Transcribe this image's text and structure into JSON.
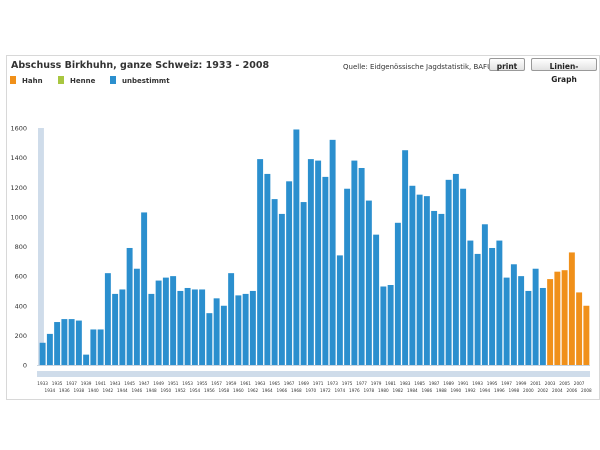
{
  "header": {
    "title": "Abschuss Birkhuhn, ganze Schweiz: 1933 - 2008",
    "source": "Quelle: Eidgenössische Jagdstatistik, BAFU",
    "print_label": "print",
    "line_graph_label": "Linien-Graph"
  },
  "colors": {
    "hahn": "#f0901a",
    "henne": "#a8c640",
    "unbestimmt": "#2b8fce",
    "background_bar": "#cfdcea"
  },
  "chart_data": {
    "type": "bar",
    "title": "Abschuss Birkhuhn, ganze Schweiz: 1933 - 2008",
    "xlabel": "",
    "ylabel": "",
    "ylim": [
      0,
      1600
    ],
    "yticks": [
      0,
      200,
      400,
      600,
      800,
      1000,
      1200,
      1400,
      1600
    ],
    "grid": false,
    "legend_position": "top-left",
    "categories": [
      "1933",
      "1934",
      "1935",
      "1936",
      "1937",
      "1938",
      "1939",
      "1940",
      "1941",
      "1942",
      "1943",
      "1944",
      "1945",
      "1946",
      "1947",
      "1948",
      "1949",
      "1950",
      "1951",
      "1952",
      "1953",
      "1954",
      "1955",
      "1956",
      "1957",
      "1958",
      "1959",
      "1960",
      "1961",
      "1962",
      "1963",
      "1964",
      "1965",
      "1966",
      "1967",
      "1968",
      "1969",
      "1970",
      "1971",
      "1972",
      "1973",
      "1974",
      "1975",
      "1976",
      "1977",
      "1978",
      "1979",
      "1980",
      "1981",
      "1982",
      "1983",
      "1984",
      "1985",
      "1986",
      "1987",
      "1988",
      "1989",
      "1990",
      "1991",
      "1992",
      "1993",
      "1994",
      "1995",
      "1996",
      "1997",
      "1998",
      "1999",
      "2000",
      "2001",
      "2002",
      "2003",
      "2004",
      "2005",
      "2006",
      "2007",
      "2008"
    ],
    "series": [
      {
        "name": "Hahn",
        "values": [
          0,
          0,
          0,
          0,
          0,
          0,
          0,
          0,
          0,
          0,
          0,
          0,
          0,
          0,
          0,
          0,
          0,
          0,
          0,
          0,
          0,
          0,
          0,
          0,
          0,
          0,
          0,
          0,
          0,
          0,
          0,
          0,
          0,
          0,
          0,
          0,
          0,
          0,
          0,
          0,
          0,
          0,
          0,
          0,
          0,
          0,
          0,
          0,
          0,
          0,
          0,
          0,
          0,
          0,
          0,
          0,
          0,
          0,
          0,
          0,
          0,
          0,
          0,
          0,
          0,
          0,
          0,
          0,
          0,
          0,
          580,
          630,
          640,
          760,
          490,
          400
        ]
      },
      {
        "name": "Henne",
        "values": [
          0,
          0,
          0,
          0,
          0,
          0,
          0,
          0,
          0,
          0,
          0,
          0,
          0,
          0,
          0,
          0,
          0,
          0,
          0,
          0,
          0,
          0,
          0,
          0,
          0,
          0,
          0,
          0,
          0,
          0,
          0,
          0,
          0,
          0,
          0,
          0,
          0,
          0,
          0,
          0,
          0,
          0,
          0,
          0,
          0,
          0,
          0,
          0,
          0,
          0,
          0,
          0,
          0,
          0,
          0,
          0,
          0,
          0,
          0,
          0,
          0,
          0,
          0,
          0,
          0,
          0,
          0,
          0,
          0,
          0,
          0,
          0,
          0,
          0,
          0,
          0
        ]
      },
      {
        "name": "unbestimmt",
        "values": [
          150,
          210,
          290,
          310,
          310,
          300,
          70,
          240,
          240,
          620,
          480,
          510,
          790,
          650,
          1030,
          480,
          570,
          590,
          600,
          500,
          520,
          510,
          510,
          350,
          450,
          400,
          620,
          470,
          480,
          500,
          1390,
          1290,
          1120,
          1020,
          1240,
          1590,
          1100,
          1390,
          1380,
          1270,
          1520,
          740,
          1190,
          1380,
          1330,
          1110,
          880,
          530,
          540,
          960,
          1450,
          1210,
          1150,
          1140,
          1040,
          1020,
          1250,
          1290,
          1190,
          840,
          750,
          950,
          790,
          840,
          590,
          680,
          600,
          500,
          650,
          520,
          0,
          0,
          0,
          0,
          0,
          0
        ]
      }
    ]
  }
}
